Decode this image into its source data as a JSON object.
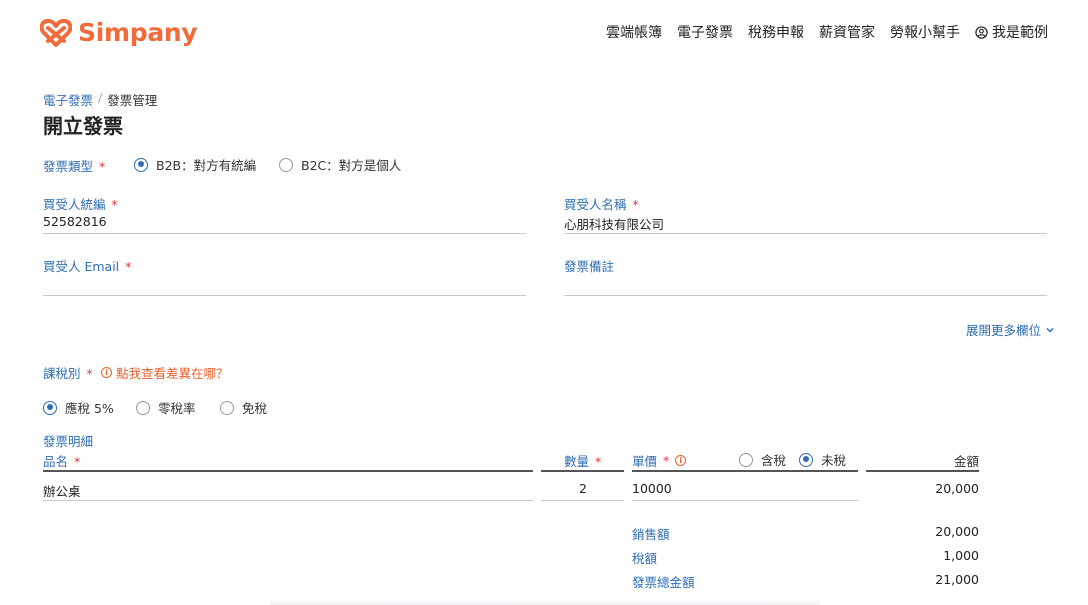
{
  "brand": {
    "name": "Simpany",
    "color": "#f26b3a",
    "accent": "#2f6db5",
    "required_color": "#d9363e"
  },
  "nav": {
    "items": [
      "雲端帳簿",
      "電子發票",
      "稅務申報",
      "薪資管家",
      "勞報小幫手"
    ],
    "user_label": "我是範例",
    "user_icon": "user-circle-icon"
  },
  "breadcrumb": {
    "parent": "電子發票",
    "separator": "/",
    "current": "發票管理"
  },
  "page": {
    "title": "開立發票"
  },
  "invoice_type": {
    "label": "發票類型",
    "required": "*",
    "options": [
      {
        "label": "B2B：對方有統編",
        "selected": true
      },
      {
        "label": "B2C：對方是個人",
        "selected": false
      }
    ]
  },
  "buyer": {
    "tax_id": {
      "label": "買受人統編",
      "required": "*",
      "value": "52582816"
    },
    "name": {
      "label": "買受人名稱",
      "required": "*",
      "value": "心朋科技有限公司"
    },
    "email": {
      "label": "買受人 Email",
      "required": "*",
      "value": ""
    },
    "note": {
      "label": "發票備註",
      "value": ""
    }
  },
  "expand": {
    "label": "展開更多欄位",
    "icon": "chevron-down-icon"
  },
  "tax_type": {
    "label": "課稅別",
    "required": "*",
    "help_label": "點我查看差異在哪？",
    "options": [
      {
        "label": "應稅 5%",
        "selected": true
      },
      {
        "label": "零稅率",
        "selected": false
      },
      {
        "label": "免稅",
        "selected": false
      }
    ]
  },
  "details": {
    "section_label": "發票明細",
    "headers": {
      "item": "品名",
      "qty": "數量",
      "price": "單價",
      "amount": "金額",
      "required": "*"
    },
    "price_mode": [
      {
        "label": "含稅",
        "selected": false
      },
      {
        "label": "未稅",
        "selected": true
      }
    ],
    "rows": [
      {
        "item": "辦公桌",
        "qty": "2",
        "price": "10000",
        "amount": "20,000"
      }
    ]
  },
  "summary": [
    {
      "label": "銷售額",
      "value": "20,000"
    },
    {
      "label": "稅額",
      "value": "1,000"
    },
    {
      "label": "發票總金額",
      "value": "21,000"
    }
  ]
}
